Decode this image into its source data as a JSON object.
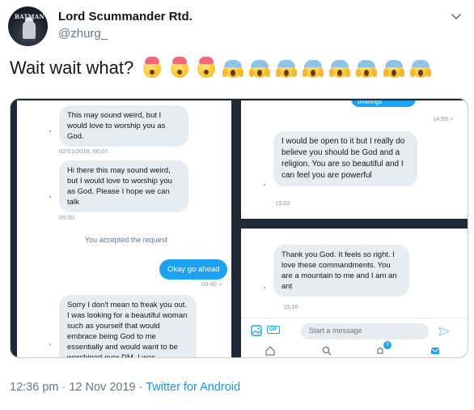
{
  "author": {
    "display_name": "Lord Scummander Rtd.",
    "handle": "@zhurg_",
    "avatar_text": "BATMAN"
  },
  "tweet": {
    "text": "Wait wait what?",
    "emojis": [
      "exploding-head",
      "exploding-head",
      "exploding-head",
      "screaming-face",
      "screaming-face",
      "screaming-face",
      "screaming-face",
      "screaming-face",
      "screaming-face",
      "screaming-face",
      "screaming-face"
    ],
    "timestamp": "12:36 pm · 12 Nov 2019 · ",
    "source": "Twitter for Android"
  },
  "media": {
    "left_panel": {
      "messages": [
        {
          "text": "This may sound weird, but I would love to worship you as God.",
          "time": "02/01/2018, 00:07"
        },
        {
          "text": "Hi there this may sound weird, but I would love to worship you as God. Please I hope we can talk",
          "time": "05:30"
        },
        {
          "note": "You accepted the request"
        },
        {
          "text": "Okay go ahead",
          "time": "09:40 ✓",
          "outgoing": true
        },
        {
          "text": "Sorry I don't mean to freak you out. I was looking for a beautiful woman such as yourself that would embrace being God to me essentially and would want to be worshiped over DM. I was"
        }
      ]
    },
    "right_top_panel": {
      "top_strip_text": "offerings",
      "top_strip_time": "14:59 ✓",
      "messages": [
        {
          "text": "I would be open to it but I really do believe you should be God and a religion. You are so beautiful and I can feel you are powerful",
          "time": "15:02"
        }
      ]
    },
    "right_bottom_panel": {
      "messages": [
        {
          "text": "Thank you God. It feels so right. I love these commandments. You are a mountain to me and I am an ant",
          "time": "15:16"
        }
      ],
      "composer_placeholder": "Start a message",
      "gif_label": "GIF",
      "notification_count": "3"
    }
  }
}
